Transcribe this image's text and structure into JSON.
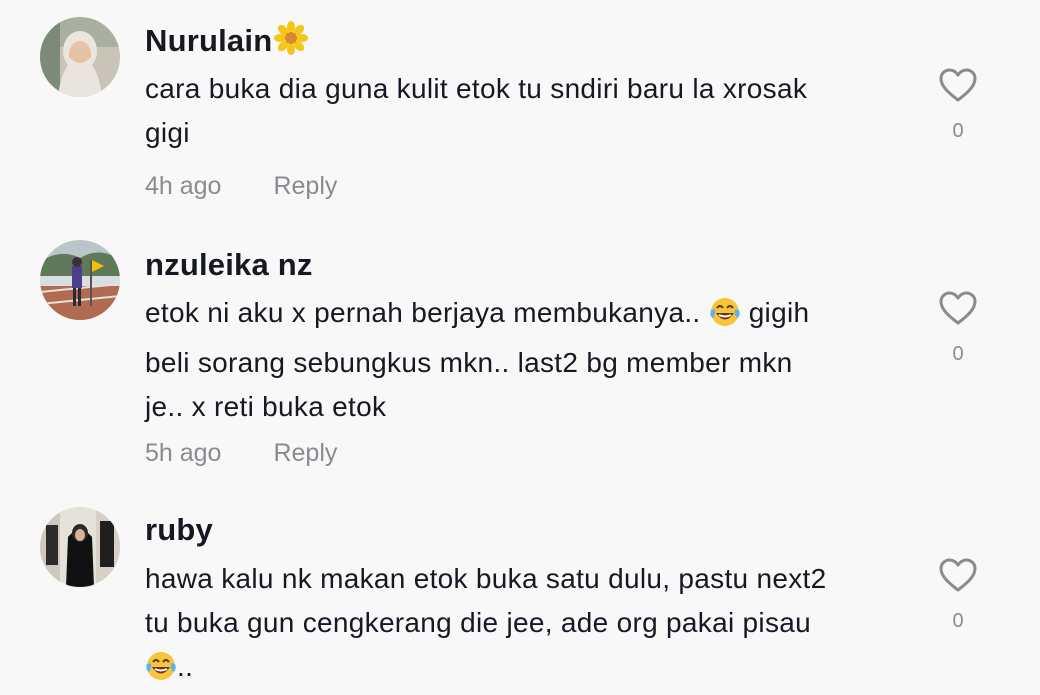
{
  "comments": [
    {
      "username": "Nurulain",
      "username_emoji_icon": "sunflower-icon",
      "line1": "cara buka dia guna kulit etok tu sndiri baru la xrosak",
      "line2": "gigi",
      "time": "4h ago",
      "reply_label": "Reply",
      "likes": "0"
    },
    {
      "username": "nzuleika nz",
      "line1_a": "etok ni aku x pernah berjaya membukanya..",
      "line1_b": "gigih",
      "line2": "beli sorang sebungkus mkn.. last2 bg member mkn",
      "line3": "je.. x reti buka etok",
      "emoji_icon": "face-with-tears-of-joy-icon",
      "time": "5h ago",
      "reply_label": "Reply",
      "likes": "0"
    },
    {
      "username": "ruby",
      "line1": "hawa kalu nk makan etok buka satu dulu, pastu next2",
      "line2": "tu buka gun cengkerang die jee, ade org pakai pisau",
      "line3_suffix": "..",
      "emoji_icon": "face-with-tears-of-joy-icon",
      "likes": "0"
    }
  ],
  "colors": {
    "background": "#f8f8f8",
    "primary_text": "#161823",
    "secondary_text": "#8a8b91",
    "heart_outline": "#8a8b91"
  }
}
